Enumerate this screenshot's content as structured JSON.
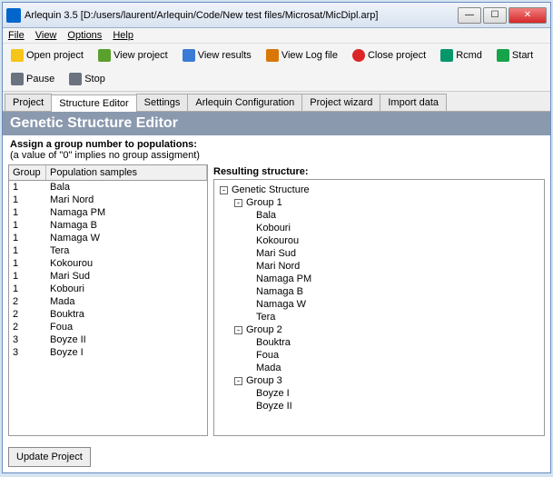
{
  "window": {
    "title": "Arlequin 3.5 [D:/users/laurent/Arlequin/Code/New test files/Microsat/MicDipl.arp]"
  },
  "menu": {
    "file": "File",
    "view": "View",
    "options": "Options",
    "help": "Help"
  },
  "toolbar": {
    "open": "Open project",
    "view": "View project",
    "results": "View results",
    "log": "View Log file",
    "close": "Close project",
    "rcmd": "Rcmd",
    "start": "Start",
    "pause": "Pause",
    "stop": "Stop"
  },
  "tabs": {
    "project": "Project",
    "structure": "Structure Editor",
    "settings": "Settings",
    "config": "Arlequin Configuration",
    "wizard": "Project wizard",
    "import": "Import data"
  },
  "editor": {
    "heading": "Genetic Structure Editor",
    "assign": "Assign a group number to populations:",
    "note": "(a value of \"0\" implies no group assigment)",
    "th_group": "Group",
    "th_pop": "Population samples",
    "rows": [
      {
        "g": "1",
        "p": "Bala"
      },
      {
        "g": "1",
        "p": "Mari Nord"
      },
      {
        "g": "1",
        "p": "Namaga PM"
      },
      {
        "g": "1",
        "p": "Namaga B"
      },
      {
        "g": "1",
        "p": "Namaga W"
      },
      {
        "g": "1",
        "p": "Tera"
      },
      {
        "g": "1",
        "p": "Kokourou"
      },
      {
        "g": "1",
        "p": "Mari Sud"
      },
      {
        "g": "1",
        "p": "Kobouri"
      },
      {
        "g": "2",
        "p": "Mada"
      },
      {
        "g": "2",
        "p": "Bouktra"
      },
      {
        "g": "2",
        "p": "Foua"
      },
      {
        "g": "3",
        "p": "Boyze II"
      },
      {
        "g": "3",
        "p": "Boyze I"
      }
    ],
    "result_head": "Resulting structure:",
    "tree": {
      "root": "Genetic Structure",
      "g1": "Group 1",
      "g2": "Group 2",
      "g3": "Group 3",
      "g1items": [
        "Bala",
        "Kobouri",
        "Kokourou",
        "Mari Sud",
        "Mari Nord",
        "Namaga PM",
        "Namaga B",
        "Namaga W",
        "Tera"
      ],
      "g2items": [
        "Bouktra",
        "Foua",
        "Mada"
      ],
      "g3items": [
        "Boyze I",
        "Boyze II"
      ]
    },
    "update": "Update Project"
  }
}
